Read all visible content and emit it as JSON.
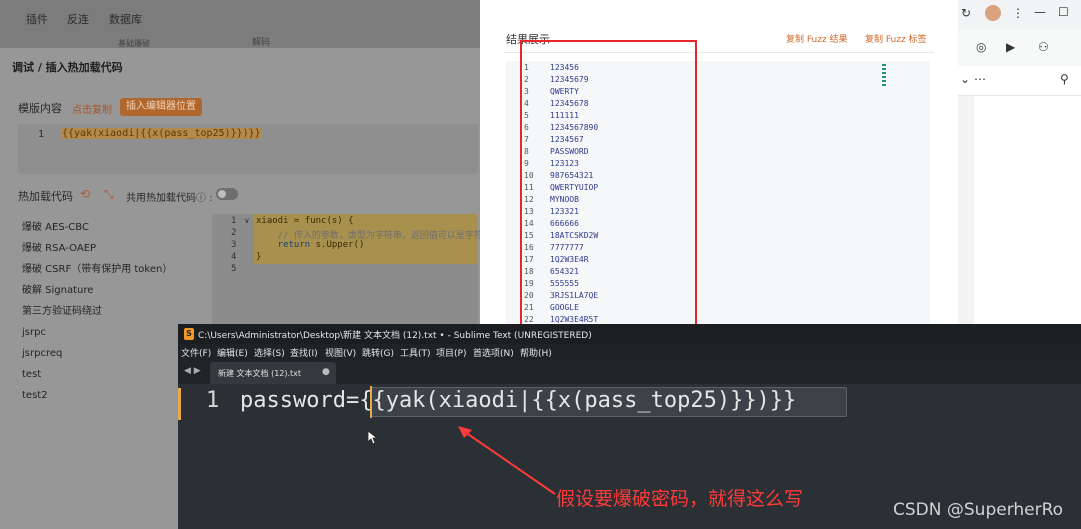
{
  "bg_menu": [
    "插件",
    "反连",
    "数据库"
  ],
  "bg_toolbar": [
    "基础爆破",
    "解码"
  ],
  "debug_panel": {
    "title": "调试 / 插入热加载代码",
    "template_label": "模版内容",
    "copy_link": "点击复制",
    "insert_button": "插入编辑器位置",
    "template_line_num": "1",
    "template_code": "{{yak(xiaodi|{{x(pass_top25)}})}}",
    "hot_label": "热加载代码",
    "shared_label": "共用热加载代码",
    "info_icon": "ⓘ :",
    "presets": [
      "爆破 AES-CBC",
      "爆破 RSA-OAEP",
      "爆破 CSRF（带有保护用 token）",
      "破解 Signature",
      "第三方验证码绕过",
      "jsrpc",
      "jsrpcreq",
      "test",
      "test2"
    ],
    "hot_line_nums": [
      "1",
      "2",
      "3",
      "4",
      "5"
    ],
    "hot_code": {
      "l1_name": "xiaodi",
      "l1_rest": " = func(s) {",
      "l2": "    // 传入的参数，类型为字符串，返回值可以是字符",
      "l3_kw": "    return",
      "l3_rest": " s.Upper()",
      "l4": "}"
    }
  },
  "result_window": {
    "title": "结果展示",
    "copy_fuzz_result": "复制 Fuzz 结果",
    "copy_fuzz_tag": "复制 Fuzz 标签",
    "rows": [
      {
        "n": "1",
        "v": "123456"
      },
      {
        "n": "2",
        "v": "12345679"
      },
      {
        "n": "3",
        "v": "QWERTY"
      },
      {
        "n": "4",
        "v": "12345678"
      },
      {
        "n": "5",
        "v": "111111"
      },
      {
        "n": "6",
        "v": "1234567890"
      },
      {
        "n": "7",
        "v": "1234567"
      },
      {
        "n": "8",
        "v": "PASSWORD"
      },
      {
        "n": "9",
        "v": "123123"
      },
      {
        "n": "10",
        "v": "987654321"
      },
      {
        "n": "11",
        "v": "QWERTYUIOP"
      },
      {
        "n": "12",
        "v": "MYNOOB"
      },
      {
        "n": "13",
        "v": "123321"
      },
      {
        "n": "14",
        "v": "666666"
      },
      {
        "n": "15",
        "v": "18ATCSKD2W"
      },
      {
        "n": "16",
        "v": "7777777"
      },
      {
        "n": "17",
        "v": "1Q2W3E4R"
      },
      {
        "n": "18",
        "v": "654321"
      },
      {
        "n": "19",
        "v": "555555"
      },
      {
        "n": "20",
        "v": "3RJS1LA7QE"
      },
      {
        "n": "21",
        "v": "GOOGLE"
      },
      {
        "n": "22",
        "v": "1Q2W3E4R5T"
      }
    ]
  },
  "sublime": {
    "title": "C:\\Users\\Administrator\\Desktop\\新建 文本文档 (12).txt • - Sublime Text (UNREGISTERED)",
    "logo": "S",
    "menu": [
      "文件(F)",
      "编辑(E)",
      "选择(S)",
      "查找(I)",
      "视图(V)",
      "跳转(G)",
      "工具(T)",
      "项目(P)",
      "首选项(N)",
      "帮助(H)"
    ],
    "nav": "◀ ▶",
    "tab_label": "新建 文本文档 (12).txt",
    "tab_dot": "●",
    "line_num": "1",
    "code": "password={{yak(xiaodi|{{x(pass_top25)}})}}"
  },
  "annotation": "假设要爆破密码，就得这么写",
  "watermark": "CSDN @SuperherRo",
  "colors": {
    "accent_orange": "#d06a2a",
    "highlight_red": "#e8262a",
    "annotation_red": "#ff3a3a"
  }
}
